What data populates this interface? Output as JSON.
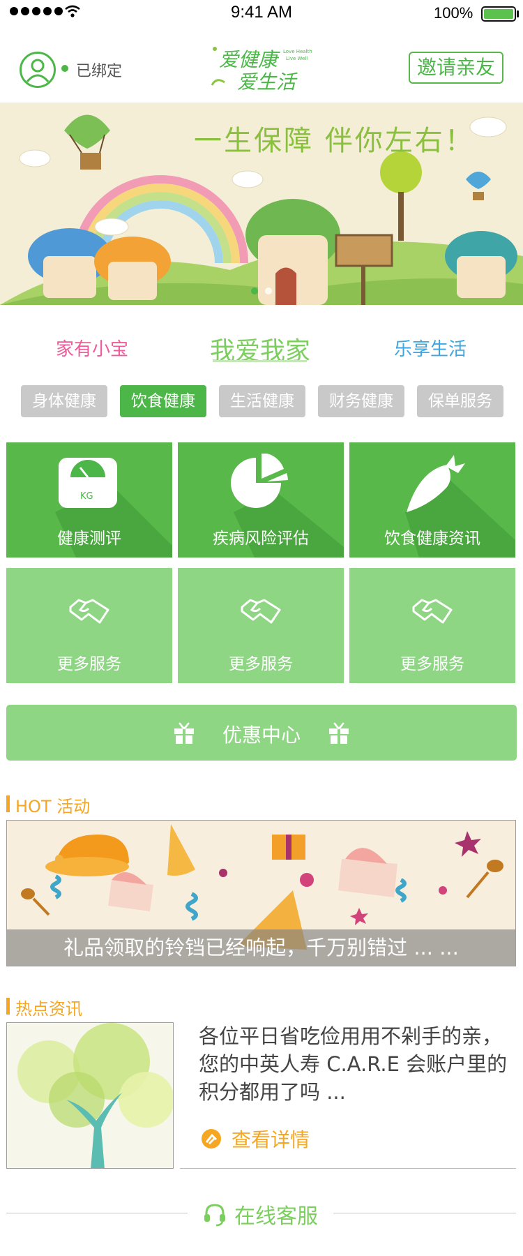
{
  "status_bar": {
    "time": "9:41 AM",
    "battery": "100%"
  },
  "header": {
    "bound_label": "已绑定",
    "invite_label": "邀请亲友",
    "logo_line1": "爱健康",
    "logo_line2": "爱生活",
    "logo_en1": "Love Health",
    "logo_en2": "Live Well"
  },
  "banner": {
    "slogan": "一生保障   伴你左右！"
  },
  "tabs": [
    {
      "label": "家有小宝"
    },
    {
      "label": "我爱我家"
    },
    {
      "label": "乐享生活"
    }
  ],
  "pills": [
    {
      "label": "身体健康"
    },
    {
      "label": "饮食健康"
    },
    {
      "label": "生活健康"
    },
    {
      "label": "财务健康"
    },
    {
      "label": "保单服务"
    }
  ],
  "tiles": [
    {
      "label": "健康测评",
      "icon": "scale-icon",
      "icon_text": "KG"
    },
    {
      "label": "疾病风险评估",
      "icon": "pie-chart-icon"
    },
    {
      "label": "饮食健康资讯",
      "icon": "carrot-icon"
    },
    {
      "label": "更多服务",
      "icon": "handshake-icon"
    },
    {
      "label": "更多服务",
      "icon": "handshake-icon"
    },
    {
      "label": "更多服务",
      "icon": "handshake-icon"
    }
  ],
  "discount": {
    "label": "优惠中心"
  },
  "hot": {
    "title": "HOT 活动",
    "caption": "礼品领取的铃铛已经响起，千万别错过 ... ..."
  },
  "news": {
    "title": "热点资讯",
    "body": "各位平日省吃俭用用不剁手的亲，您的中英人寿 C.A.R.E 会账户里的积分都用了吗 ...",
    "more": "查看详情"
  },
  "service": {
    "label": "在线客服"
  },
  "colors": {
    "primary": "#4cb748",
    "light_green": "#8ed684",
    "orange": "#f5a623",
    "pink": "#ef5b98",
    "blue": "#3ea7e2"
  }
}
